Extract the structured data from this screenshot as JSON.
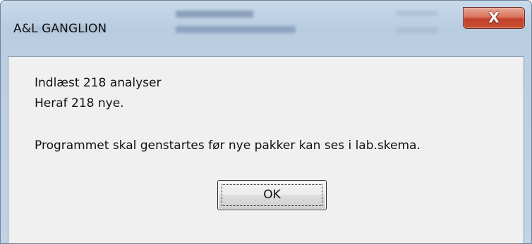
{
  "window": {
    "title": "A&L GANGLION",
    "close_icon": "close-icon",
    "close_glyph": "X"
  },
  "message": {
    "line1": "Indlæst 218 analyser",
    "line2": "Heraf 218 nye.",
    "line3": "Programmet skal genstartes før nye pakker kan ses i lab.skema."
  },
  "buttons": {
    "ok_label": "OK"
  },
  "colors": {
    "titlebar": "#b9cde1",
    "close_button": "#c84f2f",
    "client_background": "#f0f0f0"
  }
}
